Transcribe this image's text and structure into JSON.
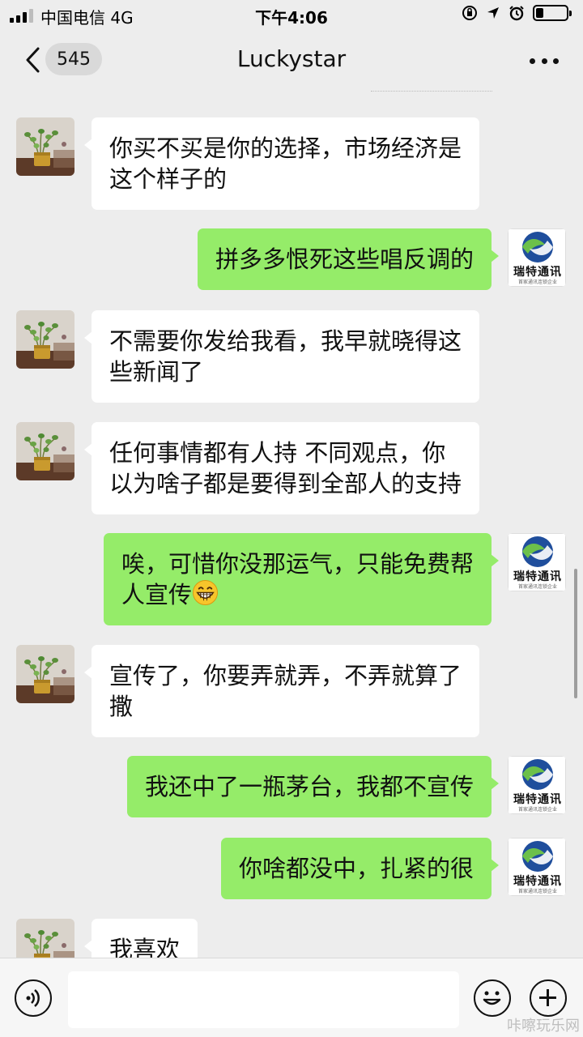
{
  "status_bar": {
    "carrier": "中国电信   4G",
    "time": "下午4:06",
    "battery_level": 0.25
  },
  "nav": {
    "unread_count": "545",
    "title": "Luckystar",
    "icons": {
      "back": "chevron-left-icon",
      "more": "more-dots-icon"
    }
  },
  "contact_avatar_label": "瑞特通讯",
  "contact_avatar_sub": "首家通讯连锁企业",
  "messages": [
    {
      "side": "in",
      "text": "你买不买是你的选择，市场经济是\n这个样子的"
    },
    {
      "side": "out",
      "text": "拼多多恨死这些唱反调的"
    },
    {
      "side": "in",
      "text": "不需要你发给我看，我早就晓得这\n些新闻了"
    },
    {
      "side": "in",
      "text": "任何事情都有人持 不同观点，你\n以为啥子都是要得到全部人的支持"
    },
    {
      "side": "out",
      "text": "唉，可惜你没那运气，只能免费帮\n人宣传",
      "emoji": "grinning-face"
    },
    {
      "side": "in",
      "text": "宣传了，你要弄就弄，不弄就算了\n撒"
    },
    {
      "side": "out",
      "text": "我还中了一瓶茅台，我都不宣传"
    },
    {
      "side": "out",
      "text": "你啥都没中，扎紧的很"
    },
    {
      "side": "in",
      "text": "我喜欢"
    }
  ],
  "input_bar": {
    "value": "",
    "icons": {
      "voice": "voice-icon",
      "emoji": "emoji-icon",
      "plus": "plus-icon"
    }
  },
  "watermark": "咔嚓玩乐网",
  "colors": {
    "outgoing_bubble": "#95ec69",
    "incoming_bubble": "#ffffff",
    "background": "#ededed"
  }
}
